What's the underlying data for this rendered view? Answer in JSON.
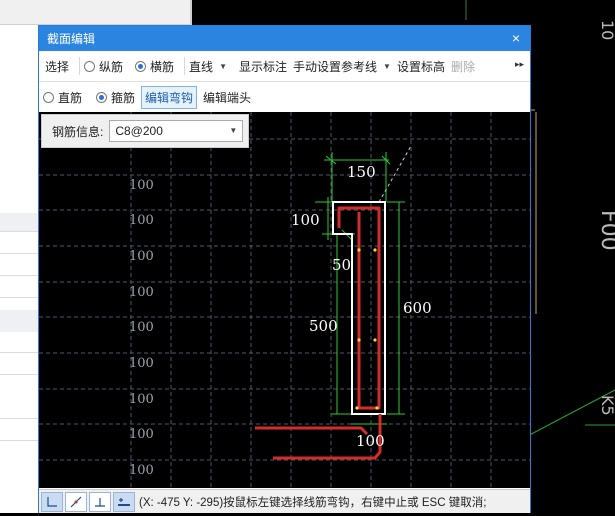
{
  "dialog": {
    "title": "截面编辑",
    "close_glyph": "×"
  },
  "toolbar1": {
    "select": "选择",
    "longitudinal": "纵筋",
    "transverse": "横筋",
    "line_type": "直线",
    "show_annotation": "显示标注",
    "manual_ref_line": "手动设置参考线",
    "set_elevation": "设置标高",
    "delete": "删除",
    "more_glyph": "▸▸"
  },
  "toolbar2": {
    "straight": "直筋",
    "stirrup": "箍筋",
    "edit_hook": "编辑弯钩",
    "edit_end": "编辑端头"
  },
  "info": {
    "label": "钢筋信息:",
    "value": "C8@200"
  },
  "drawing": {
    "grid_labels": [
      "100",
      "100",
      "100",
      "100",
      "100",
      "100",
      "100",
      "100",
      "100"
    ],
    "dim_top": "150",
    "dim_left_top": "100",
    "dim_inner": "50",
    "dim_left": "500",
    "dim_right": "600",
    "dim_bottom": "100",
    "colors": {
      "grid": "#4a5a6a",
      "dimension": "#2ecc2e",
      "outline": "#ffffff",
      "rebar": "#d42b2b",
      "label": "#9aa4ae"
    }
  },
  "statusbar": {
    "text": "(X: -475 Y: -295)按鼠标左键选择线筋弯钩，右键中止或 ESC 键取消;",
    "tool_icons": [
      "corner-snap-icon",
      "line-snap-icon",
      "perpendicular-snap-icon",
      "midpoint-snap-icon"
    ]
  }
}
